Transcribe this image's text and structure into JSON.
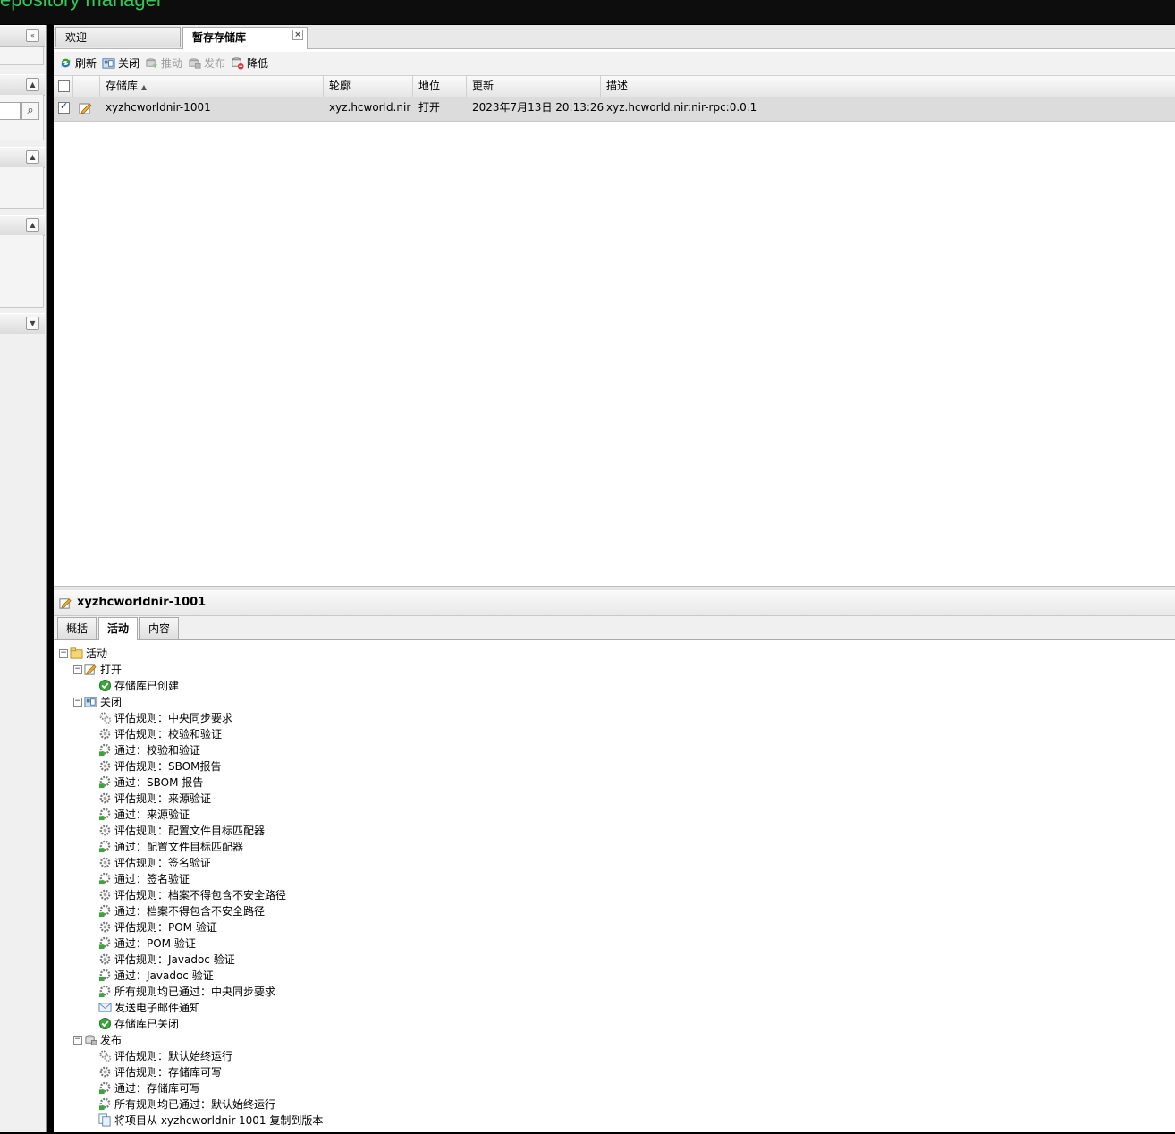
{
  "app": {
    "title": "epository manager"
  },
  "sidebar": {
    "collapse_label": "«",
    "collapse_up": "▲",
    "collapse_down": "▼",
    "search_icon": "⌕"
  },
  "tabs": [
    {
      "label": "欢迎"
    },
    {
      "label": "暂存存储库",
      "close": "×"
    }
  ],
  "toolbar": {
    "refresh": "刷新",
    "close": "关闭",
    "promote": "推动",
    "release": "发布",
    "drop": "降低"
  },
  "grid": {
    "headers": {
      "repository": "存储库",
      "sort_indicator": "▲",
      "profile": "轮廓",
      "status": "地位",
      "updated": "更新",
      "description": "描述"
    },
    "rows": [
      {
        "repository": "xyzhcworldnir-1001",
        "profile": "xyz.hcworld.nir",
        "status": "打开",
        "updated": "2023年7月13日 20:13:26",
        "description": "xyz.hcworld.nir:nir-rpc:0.0.1"
      }
    ]
  },
  "detail": {
    "title": "xyzhcworldnir-1001",
    "tabs": [
      "概括",
      "活动",
      "内容"
    ],
    "tree": {
      "root": "活动",
      "groups": [
        {
          "label": "打开",
          "items": [
            "存储库已创建"
          ]
        },
        {
          "label": "关闭",
          "items": [
            "评估规则：中央同步要求",
            "评估规则：校验和验证",
            "通过：校验和验证",
            "评估规则：SBOM报告",
            "通过：SBOM 报告",
            "评估规则：来源验证",
            "通过：来源验证",
            "评估规则：配置文件目标匹配器",
            "通过：配置文件目标匹配器",
            "评估规则：签名验证",
            "通过：签名验证",
            "评估规则：档案不得包含不安全路径",
            "通过：档案不得包含不安全路径",
            "评估规则：POM 验证",
            "通过：POM 验证",
            "评估规则：Javadoc 验证",
            "通过：Javadoc 验证",
            "所有规则均已通过：中央同步要求",
            "发送电子邮件通知",
            "存储库已关闭"
          ]
        },
        {
          "label": "发布",
          "items": [
            "评估规则：默认始终运行",
            "评估规则：存储库可写",
            "通过：存储库可写",
            "所有规则均已通过：默认始终运行",
            "将项目从 xyzhcworldnir-1001 复制到版本"
          ]
        }
      ]
    }
  }
}
